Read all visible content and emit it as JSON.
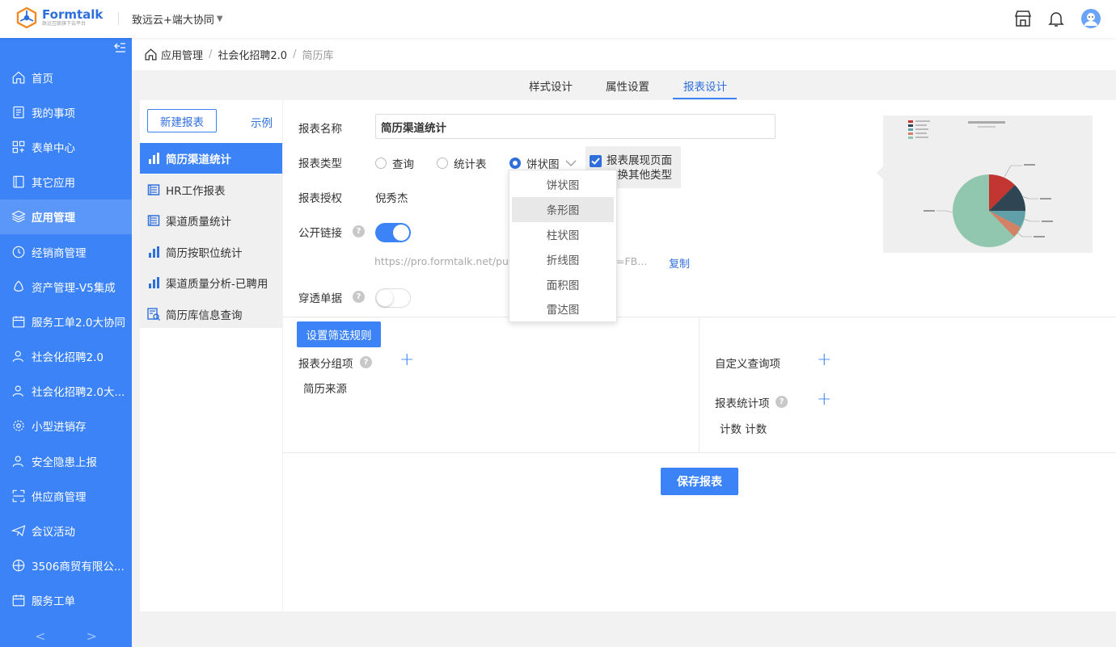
{
  "header": {
    "brand_name": "Formtalk",
    "brand_sub": "致远互联旗下云平台",
    "org": "致远云+端大协同"
  },
  "sidebar": {
    "items": [
      {
        "label": "首页",
        "icon": "home-icon"
      },
      {
        "label": "我的事项",
        "icon": "clipboard-icon"
      },
      {
        "label": "表单中心",
        "icon": "grid-icon"
      },
      {
        "label": "其它应用",
        "icon": "book-icon"
      },
      {
        "label": "应用管理",
        "icon": "layers-icon",
        "active": true
      },
      {
        "label": "经销商管理",
        "icon": "clock-icon"
      },
      {
        "label": "资产管理-V5集成",
        "icon": "shield-icon"
      },
      {
        "label": "服务工单2.0大协同",
        "icon": "calendar-icon"
      },
      {
        "label": "社会化招聘2.0",
        "icon": "user-icon"
      },
      {
        "label": "社会化招聘2.0大...",
        "icon": "user-icon"
      },
      {
        "label": "小型进销存",
        "icon": "gear-icon"
      },
      {
        "label": "安全隐患上报",
        "icon": "user-icon"
      },
      {
        "label": "供应商管理",
        "icon": "frame-icon"
      },
      {
        "label": "会议活动",
        "icon": "plane-icon"
      },
      {
        "label": "3506商贸有限公...",
        "icon": "ball-icon"
      },
      {
        "label": "服务工单",
        "icon": "calendar-icon"
      }
    ],
    "prev": "<",
    "next": ">"
  },
  "breadcrumb": {
    "home": "应用管理",
    "app": "社会化招聘2.0",
    "sep": "/",
    "current": "简历库"
  },
  "tabs": [
    {
      "label": "样式设计"
    },
    {
      "label": "属性设置"
    },
    {
      "label": "报表设计",
      "active": true
    }
  ],
  "report_list": {
    "new_button": "新建报表",
    "example_link": "示例",
    "items": [
      {
        "label": "简历渠道统计",
        "icon": "bar-chart-icon",
        "active": true
      },
      {
        "label": "HR工作报表",
        "icon": "list-icon"
      },
      {
        "label": "渠道质量统计",
        "icon": "list-icon"
      },
      {
        "label": "简历按职位统计",
        "icon": "bar-chart-icon"
      },
      {
        "label": "渠道质量分析-已聘用",
        "icon": "bar-chart-icon"
      },
      {
        "label": "简历库信息查询",
        "icon": "search-doc-icon"
      }
    ]
  },
  "form": {
    "name_label": "报表名称",
    "name_value": "简历渠道统计",
    "type_label": "报表类型",
    "type_options": [
      "查询",
      "统计表",
      "饼状图"
    ],
    "type_selected": "饼状图",
    "display_checkbox_line1": "报表展现页面",
    "display_checkbox_line2": "切换其他类型",
    "auth_label": "报表授权",
    "auth_value": "倪秀杰",
    "public_link_label": "公开链接",
    "public_link_url": "https://pro.formtalk.net/pub.d",
    "public_link_tail": "=FB...",
    "copy_label": "复制",
    "drill_label": "穿透单据",
    "filter_button": "设置筛选规则",
    "group_label": "报表分组项",
    "group_value": "简历来源",
    "custom_query_label": "自定义查询项",
    "stat_label": "报表统计项",
    "stat_value": "计数 计数",
    "save_button": "保存报表",
    "help_glyph": "?",
    "plus_glyph": "+"
  },
  "chart_type_dropdown": {
    "options": [
      "饼状图",
      "条形图",
      "柱状图",
      "折线图",
      "面积图",
      "雷达图"
    ],
    "hovered": "条形图"
  },
  "colors": {
    "primary": "#3b83f7",
    "sidebar": "#3b83f7",
    "link": "#2f6fdc"
  }
}
